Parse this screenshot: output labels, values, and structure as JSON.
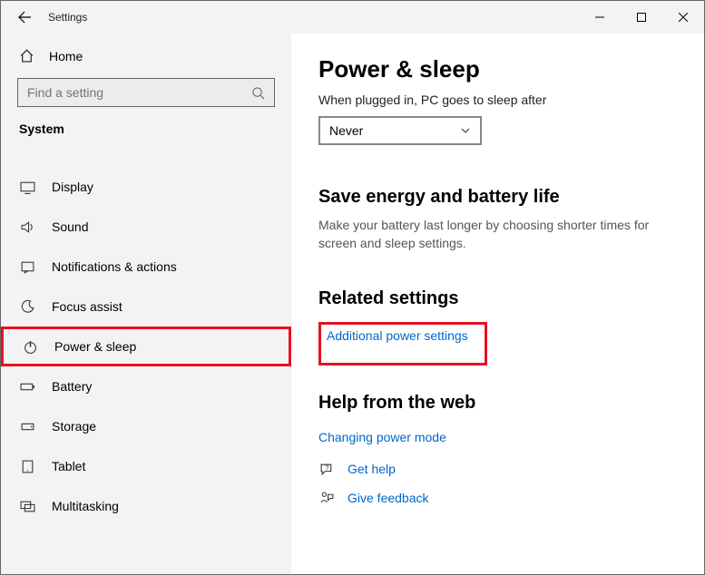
{
  "window": {
    "title": "Settings"
  },
  "sidebar": {
    "home_label": "Home",
    "search_placeholder": "Find a setting",
    "section_label": "System",
    "items": [
      {
        "label": "Display"
      },
      {
        "label": "Sound"
      },
      {
        "label": "Notifications & actions"
      },
      {
        "label": "Focus assist"
      },
      {
        "label": "Power & sleep"
      },
      {
        "label": "Battery"
      },
      {
        "label": "Storage"
      },
      {
        "label": "Tablet"
      },
      {
        "label": "Multitasking"
      }
    ]
  },
  "main": {
    "title": "Power & sleep",
    "plugged_label": "When plugged in, PC goes to sleep after",
    "plugged_value": "Never",
    "energy_heading": "Save energy and battery life",
    "energy_desc": "Make your battery last longer by choosing shorter times for screen and sleep settings.",
    "related_heading": "Related settings",
    "related_link": "Additional power settings",
    "help_heading": "Help from the web",
    "help_link": "Changing power mode",
    "get_help_label": "Get help",
    "feedback_label": "Give feedback"
  }
}
